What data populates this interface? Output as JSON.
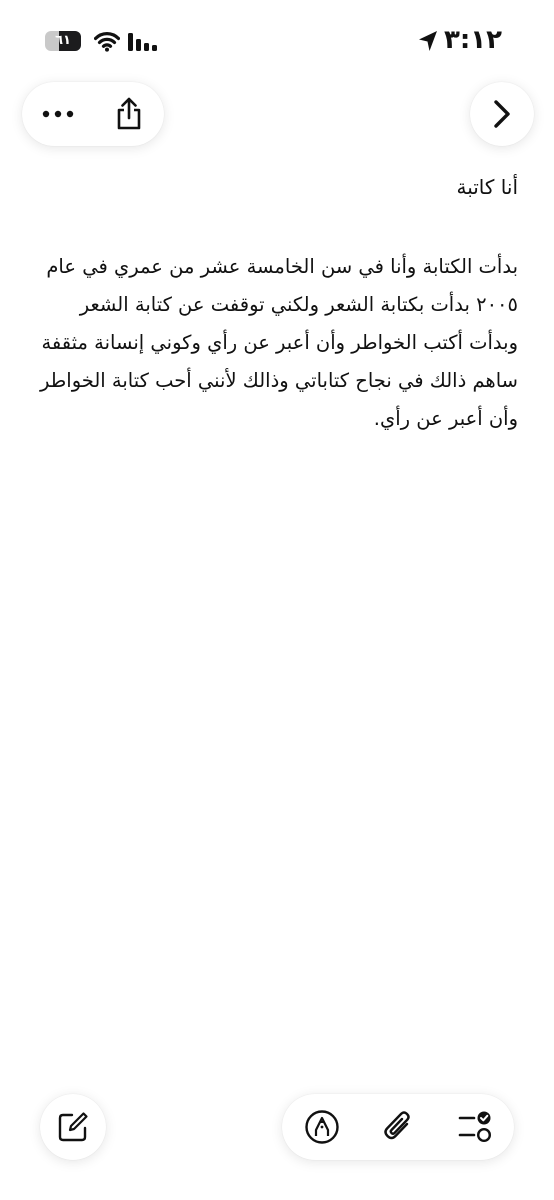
{
  "status_bar": {
    "time": "٣:١٢",
    "battery_label": "٦١",
    "battery_level": 0.61,
    "icons": [
      "battery-icon",
      "wifi-icon",
      "signal-icon",
      "location-arrow-icon"
    ]
  },
  "toolbar": {
    "icons": [
      "ellipsis-icon",
      "share-icon",
      "chevron-right-icon"
    ]
  },
  "note": {
    "title": "أنا كاتبة",
    "body": "بدأت الكتابة وأنا في سن الخامسة عشر من عمري في عام ٢٠٠٥ بدأت بكتابة الشعر ولكني توقفت عن كتابة الشعر وبدأت أكتب الخواطر وأن أعبر عن رأي وكوني إنسانة مثقفة ساهم ذالك في نجاح كتاباتي وذالك لأنني أحب كتابة الخواطر وأن أعبر عن رأي."
  },
  "bottom_toolbar": {
    "icons": [
      "compose-icon",
      "markup-pen-icon",
      "paperclip-icon",
      "checklist-icon"
    ]
  },
  "colors": {
    "background": "#ffffff",
    "text": "#111111",
    "icon": "#111111",
    "battery_track": "#c9c9c9"
  }
}
